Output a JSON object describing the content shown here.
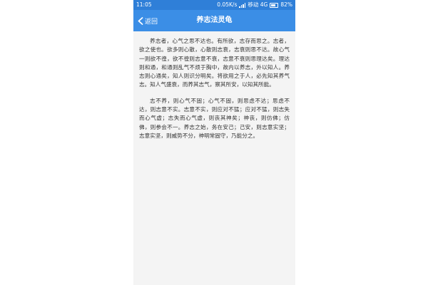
{
  "status_bar": {
    "time": "11:05",
    "net_speed": "0.05K/s",
    "carrier": "移动 4G",
    "battery": "82%"
  },
  "nav": {
    "back_label": "返回",
    "title": "养志法灵龟"
  },
  "content": {
    "paragraphs": [
      "养志者，心气之思不达也。有所欲，志存而思之。志者，欲之使也。欲多则心散，心散则志衰，志衰则思不达。故心气一则欲不徨，欲不徨则志意不衰，志意不衰则思理达矣。理达则和通，和通则乱气不烦于胸中，故内以养志，外以知人。养志则心通矣，知人则识分明矣。将欲用之于人，必先知其养气志。知人气盛衰，而养其志气，察其所安，以知其所能。",
      "志不养，则心气不固；心气不固，则思虑不达；思虑不达，则志意不实。志意不实，则应对不猛；应对不猛，则志失而心气虚；志失而心气虚，则丧其神矣；神丧，则仿佛；仿佛，则参会不一。养志之始，务在安己；己安，则志意实坚；志意实坚，则威势不分，神明常固守，乃能分之。"
    ]
  },
  "colors": {
    "status_bar": "#2f7fd8",
    "nav_bar": "#3b8ee6",
    "background": "#f4f4f4",
    "text": "#333333"
  }
}
